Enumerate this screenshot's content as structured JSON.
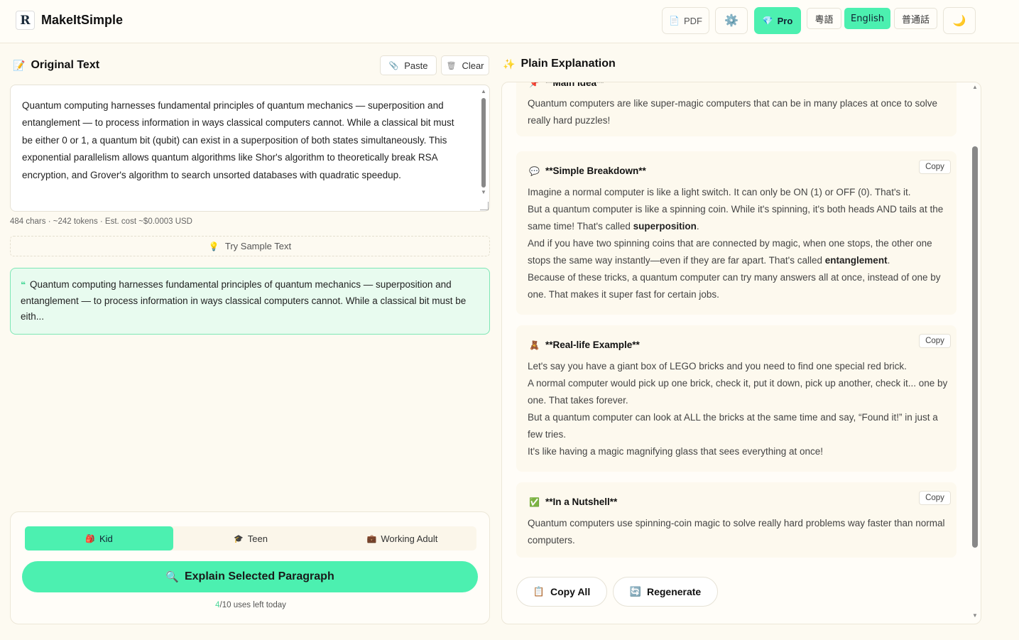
{
  "app": {
    "name": "MakeItSimple",
    "logo_letter": "R"
  },
  "header": {
    "pdf_label": "PDF",
    "pro_label": "Pro",
    "languages": [
      "粵語",
      "English",
      "普通話"
    ],
    "active_language": "English"
  },
  "original": {
    "title": "Original Text",
    "paste_label": "Paste",
    "clear_label": "Clear",
    "text": "Quantum computing harnesses fundamental principles of quantum mechanics — superposition and entanglement — to process information in ways classical computers cannot. While a classical bit must be either 0 or 1, a quantum bit (qubit) can exist in a superposition of both states simultaneously. This exponential parallelism allows quantum algorithms like Shor's algorithm to theoretically break RSA encryption, and Grover's algorithm to search unsorted databases with quadratic speedup.",
    "meta": "484 chars · ~242 tokens · Est. cost ~$0.0003 USD",
    "sample_label": "Try Sample Text",
    "selected_preview": "Quantum computing harnesses fundamental principles of quantum mechanics — superposition and entanglement — to process information in ways classical computers cannot. While a classical bit must be eith..."
  },
  "controls": {
    "modes": [
      "Kid",
      "Teen",
      "Working Adult"
    ],
    "active_mode": "Kid",
    "explain_label": "Explain Selected Paragraph",
    "uses_used": "4",
    "uses_rest": "/10 uses left today"
  },
  "explanation": {
    "title": "Plain Explanation",
    "copy_label": "Copy",
    "sections": [
      {
        "title": "**Main Idea**",
        "icon": "pin-icon",
        "lines": [
          "Quantum computers are like super-magic computers that can be in many places at once to solve really hard puzzles!"
        ]
      },
      {
        "title": "**Simple Breakdown**",
        "icon": "speech-bubble-icon",
        "lines": [
          "Imagine a normal computer is like a light switch. It can only be ON (1) or OFF (0). That's it.",
          "But a quantum computer is like a spinning coin. While it's spinning, it's both heads AND tails at the same time! That's called ",
          "superposition",
          ".",
          "And if you have two spinning coins that are connected by magic, when one stops, the other one stops the same way instantly—even if they are far apart. That's called ",
          "entanglement",
          ".",
          "Because of these tricks, a quantum computer can try many answers all at once, instead of one by one. That makes it super fast for certain jobs."
        ]
      },
      {
        "title": "**Real-life Example**",
        "icon": "teddy-bear-icon",
        "lines": [
          "Let's say you have a giant box of LEGO bricks and you need to find one special red brick.",
          "A normal computer would pick up one brick, check it, put it down, pick up another, check it... one by one. That takes forever.",
          "But a quantum computer can look at ALL the bricks at the same time and say, “Found it!” in just a few tries.",
          "It's like having a magic magnifying glass that sees everything at once!"
        ]
      },
      {
        "title": "**In a Nutshell**",
        "icon": "check-box-icon",
        "lines": [
          "Quantum computers use spinning-coin magic to solve really hard problems way faster than normal computers."
        ]
      }
    ],
    "copy_all_label": "Copy All",
    "regenerate_label": "Regenerate"
  }
}
